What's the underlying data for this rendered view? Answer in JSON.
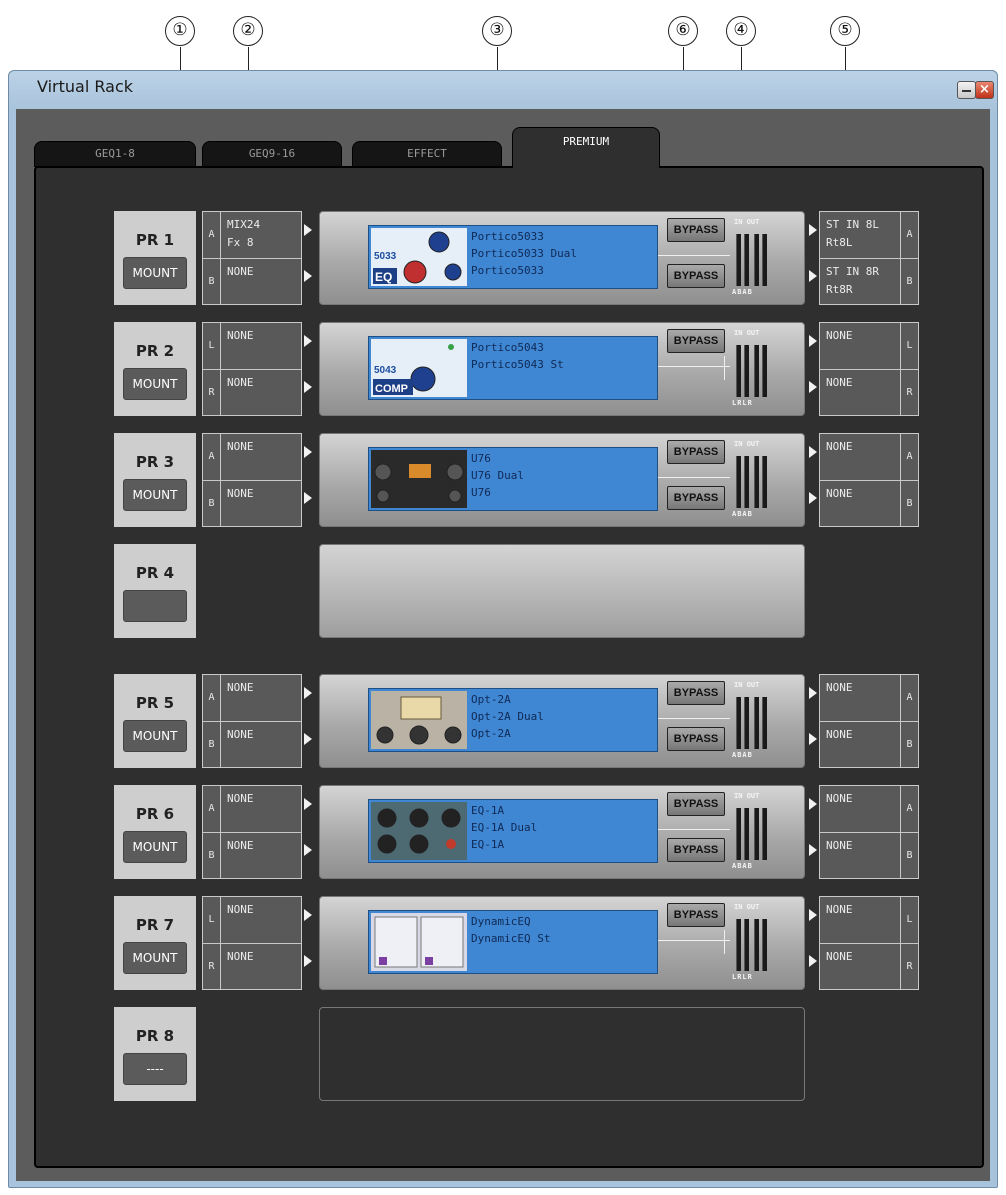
{
  "callouts": [
    "①",
    "②",
    "③",
    "⑥",
    "④",
    "⑤"
  ],
  "window": {
    "title": "Virtual Rack",
    "close_glyph": "×"
  },
  "tabs": [
    "GEQ1-8",
    "GEQ9-16",
    "EFFECT",
    "PREMIUM"
  ],
  "active_tab": "PREMIUM",
  "rows": [
    {
      "slot": "PR 1",
      "mount": "MOUNT",
      "in": [
        {
          "ch": "A",
          "text": "MIX24\nFx 8"
        },
        {
          "ch": "B",
          "text": "NONE"
        }
      ],
      "names": "Portico5033\nPortico5033 Dual\nPortico5033",
      "bypass": [
        "BYPASS",
        "BYPASS"
      ],
      "meter_top": "IN OUT",
      "meter_bottom": "ABAB",
      "out": [
        {
          "ch": "A",
          "text": "ST IN 8L\nRt8L"
        },
        {
          "ch": "B",
          "text": "ST IN 8R\nRt8R"
        }
      ]
    },
    {
      "slot": "PR 2",
      "mount": "MOUNT",
      "in": [
        {
          "ch": "L",
          "text": "NONE"
        },
        {
          "ch": "R",
          "text": "NONE"
        }
      ],
      "names": "Portico5043\nPortico5043 St",
      "bypass": [
        "BYPASS"
      ],
      "meter_top": "IN OUT",
      "meter_bottom": "LRLR",
      "out": [
        {
          "ch": "L",
          "text": "NONE"
        },
        {
          "ch": "R",
          "text": "NONE"
        }
      ]
    },
    {
      "slot": "PR 3",
      "mount": "MOUNT",
      "in": [
        {
          "ch": "A",
          "text": "NONE"
        },
        {
          "ch": "B",
          "text": "NONE"
        }
      ],
      "names": "U76\nU76 Dual\nU76",
      "bypass": [
        "BYPASS",
        "BYPASS"
      ],
      "meter_top": "IN OUT",
      "meter_bottom": "ABAB",
      "out": [
        {
          "ch": "A",
          "text": "NONE"
        },
        {
          "ch": "B",
          "text": "NONE"
        }
      ]
    },
    {
      "slot": "PR 4",
      "mount": ""
    },
    {
      "slot": "PR 5",
      "mount": "MOUNT",
      "in": [
        {
          "ch": "A",
          "text": "NONE"
        },
        {
          "ch": "B",
          "text": "NONE"
        }
      ],
      "names": "Opt-2A\nOpt-2A Dual\nOpt-2A",
      "bypass": [
        "BYPASS",
        "BYPASS"
      ],
      "meter_top": "IN OUT",
      "meter_bottom": "ABAB",
      "out": [
        {
          "ch": "A",
          "text": "NONE"
        },
        {
          "ch": "B",
          "text": "NONE"
        }
      ]
    },
    {
      "slot": "PR 6",
      "mount": "MOUNT",
      "in": [
        {
          "ch": "A",
          "text": "NONE"
        },
        {
          "ch": "B",
          "text": "NONE"
        }
      ],
      "names": "EQ-1A\nEQ-1A Dual\nEQ-1A",
      "bypass": [
        "BYPASS",
        "BYPASS"
      ],
      "meter_top": "IN OUT",
      "meter_bottom": "ABAB",
      "out": [
        {
          "ch": "A",
          "text": "NONE"
        },
        {
          "ch": "B",
          "text": "NONE"
        }
      ]
    },
    {
      "slot": "PR 7",
      "mount": "MOUNT",
      "in": [
        {
          "ch": "L",
          "text": "NONE"
        },
        {
          "ch": "R",
          "text": "NONE"
        }
      ],
      "names": "DynamicEQ\nDynamicEQ St",
      "bypass": [
        "BYPASS"
      ],
      "meter_top": "IN OUT",
      "meter_bottom": "LRLR",
      "out": [
        {
          "ch": "L",
          "text": "NONE"
        },
        {
          "ch": "R",
          "text": "NONE"
        }
      ]
    },
    {
      "slot": "PR 8",
      "mount": "----"
    }
  ],
  "thumb_labels": {
    "pr1_a": "5033",
    "pr1_b": "EQ",
    "pr2_a": "5043",
    "pr2_b": "COMP"
  }
}
